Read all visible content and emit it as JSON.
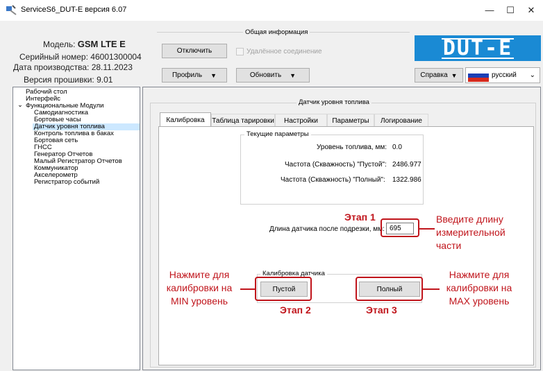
{
  "window": {
    "title": "ServiceS6_DUT-E версия 6.07",
    "minimize": "—",
    "maximize": "☐",
    "close": "✕"
  },
  "info": {
    "model_label": "Модель:",
    "model_value": "GSM LTE E",
    "serial_label": "Серийный номер:",
    "serial_value": "46001300004",
    "date_label": "Дата производства:",
    "date_value": "28.11.2023",
    "firmware_label": "Версия прошивки:",
    "firmware_value": "9.01"
  },
  "general": {
    "title": "Общая информация",
    "disconnect": "Отключить",
    "remote": "Удалённое соединение",
    "profile": "Профиль",
    "update": "Обновить",
    "help": "Справка",
    "language": "русский"
  },
  "logo": {
    "text": "DUT-E"
  },
  "tree": {
    "items": [
      "Рабочий стол",
      "Интерфейс",
      "Функциональные Модули",
      "Самодиагностика",
      "Бортовые часы",
      "Датчик уровня топлива",
      "Контроль топлива в баках",
      "Бортовая сеть",
      "ГНСС",
      "Генератор Отчетов",
      "Малый Регистратор Отчетов",
      "Коммуникатор",
      "Акселерометр",
      "Регистратор событий"
    ],
    "expander": "⌄"
  },
  "sensor": {
    "group_title": "Датчик уровня топлива",
    "tabs": [
      "Калибровка",
      "Таблица тарировки",
      "Настройки",
      "Параметры",
      "Логирование"
    ],
    "current_params_title": "Текущие параметры",
    "fuel_level_label": "Уровень топлива, мм:",
    "fuel_level_value": "0.0",
    "freq_empty_label": "Частота (Скважность) \"Пустой\":",
    "freq_empty_value": "2486.977",
    "freq_full_label": "Частота (Скважность) \"Полный\":",
    "freq_full_value": "1322.986",
    "length_label": "Длина датчика после подрезки, мм:",
    "length_value": "695",
    "calib_title": "Калибровка датчика",
    "empty_btn": "Пустой",
    "full_btn": "Полный"
  },
  "annotations": {
    "step1": "Этап 1",
    "step2": "Этап 2",
    "step3": "Этап 3",
    "length_hint": [
      "Введите длину",
      "измерительной",
      "части"
    ],
    "min_hint": [
      "Нажмите для",
      "калибровки на",
      "MIN уровень"
    ],
    "max_hint": [
      "Нажмите для",
      "калибровки на",
      "MAX уровень"
    ],
    "color": "#c0141b"
  },
  "colors": {
    "logo_bg": "#1a8ad4",
    "selection": "#cce8ff"
  }
}
